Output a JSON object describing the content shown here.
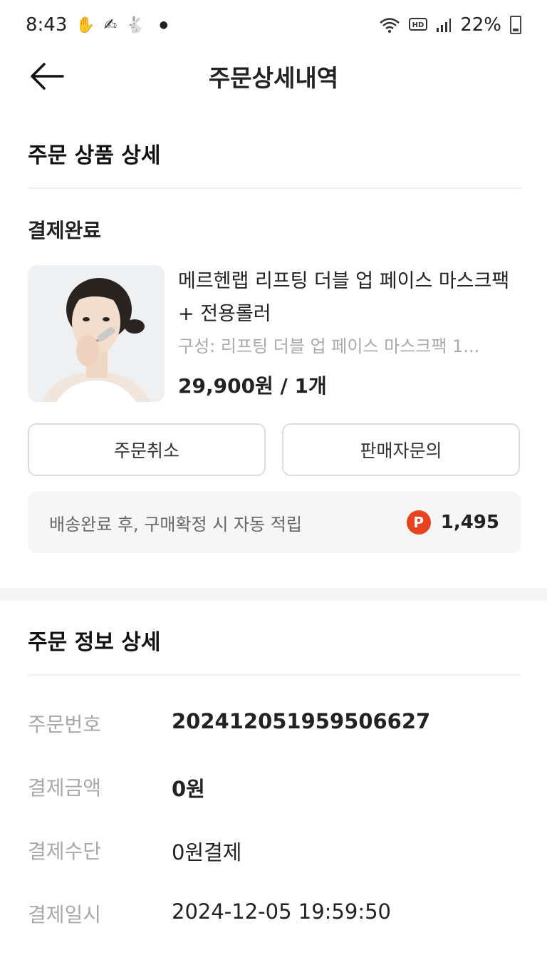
{
  "status_bar": {
    "time": "8:43",
    "notif_icons": [
      "hand-icon",
      "app-icon",
      "rabbit-icon"
    ],
    "battery": "22%",
    "system_icons": [
      "wifi-icon",
      "hd-icon",
      "signal-icon",
      "battery-icon"
    ]
  },
  "header": {
    "title": "주문상세내역",
    "back_icon": "back-arrow-icon"
  },
  "product_section": {
    "title": "주문 상품 상세",
    "status": "결제완료",
    "product": {
      "name": "메르헨랩 리프팅 더블 업 페이스 마스크팩 + 전용롤러",
      "option": "구성: 리프팅 더블 업 페이스 마스크팩 1...",
      "price": "29,900원 / 1개"
    },
    "buttons": {
      "cancel": "주문취소",
      "inquiry": "판매자문의"
    },
    "points": {
      "text": "배송완료 후, 구매확정 시 자동 적립",
      "icon_letter": "P",
      "value": "1,495",
      "color": "#e8421f"
    }
  },
  "info_section": {
    "title": "주문 정보 상세",
    "rows": [
      {
        "label": "주문번호",
        "value": "20241205195950662 7"
      },
      {
        "label": "결제금액",
        "value": "0원"
      },
      {
        "label": "결제수단",
        "value": "0원결제"
      },
      {
        "label": "결제일시",
        "value": "2024-12-05 19:59:50"
      }
    ]
  }
}
